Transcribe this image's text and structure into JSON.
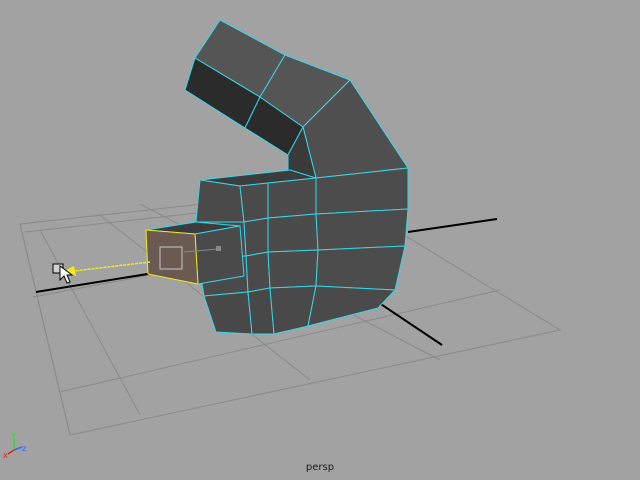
{
  "viewport": {
    "camera_label": "persp",
    "background_color": "#a2a2a2",
    "grid_color": "#8a8a8a",
    "axis_line_color": "#000000",
    "wireframe_color": "#36d7e8",
    "face_color": "#4a4a4a",
    "dark_face_color": "#2c2c2c",
    "selection_highlight_color": "#f2ea1c",
    "object": "polygon-mesh-with-extruded-tube",
    "selected_component": "face",
    "manipulator": "move-tool",
    "cursor": "arrow-pointer"
  },
  "axis_gizmo": {
    "x_label": "x",
    "y_label": "y",
    "z_label": "z",
    "x_color": "#e0201b",
    "y_color": "#2fdc2f",
    "z_color": "#3366ff"
  }
}
